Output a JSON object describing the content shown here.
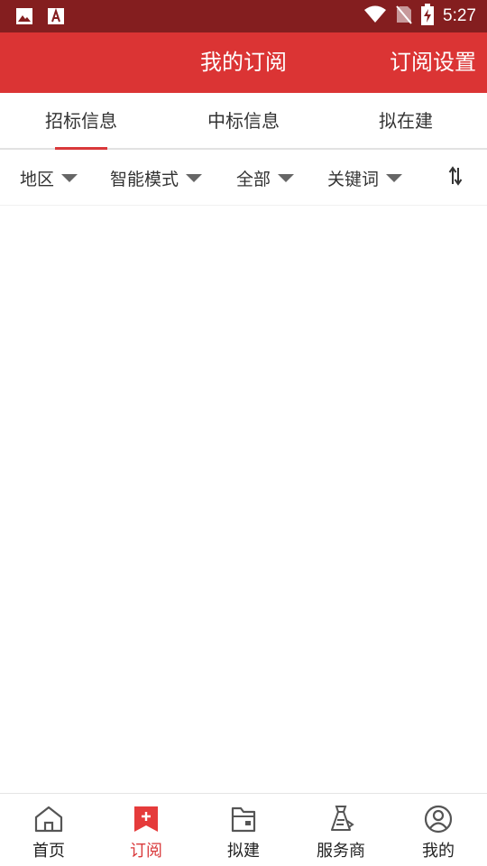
{
  "status_bar": {
    "time": "5:27",
    "icons": [
      "image-icon",
      "font-icon",
      "wifi-icon",
      "no-sim-icon",
      "battery-charging-icon"
    ]
  },
  "header": {
    "title": "我的订阅",
    "action_label": "订阅设置"
  },
  "tabs": [
    {
      "label": "招标信息",
      "active": true
    },
    {
      "label": "中标信息",
      "active": false
    },
    {
      "label": "拟在建",
      "active": false
    }
  ],
  "filters": [
    {
      "label": "地区"
    },
    {
      "label": "智能模式"
    },
    {
      "label": "全部"
    },
    {
      "label": "关键词"
    }
  ],
  "sort_icon": "sort-icon",
  "bottom_nav": [
    {
      "label": "首页",
      "icon": "home-icon",
      "active": false
    },
    {
      "label": "订阅",
      "icon": "subscribe-icon",
      "active": true
    },
    {
      "label": "拟建",
      "icon": "folder-icon",
      "active": false
    },
    {
      "label": "服务商",
      "icon": "service-provider-icon",
      "active": false
    },
    {
      "label": "我的",
      "icon": "profile-icon",
      "active": false
    }
  ],
  "colors": {
    "status_bar": "#841e1f",
    "header": "#db3434",
    "accent": "#d9383a",
    "text": "#333333"
  }
}
